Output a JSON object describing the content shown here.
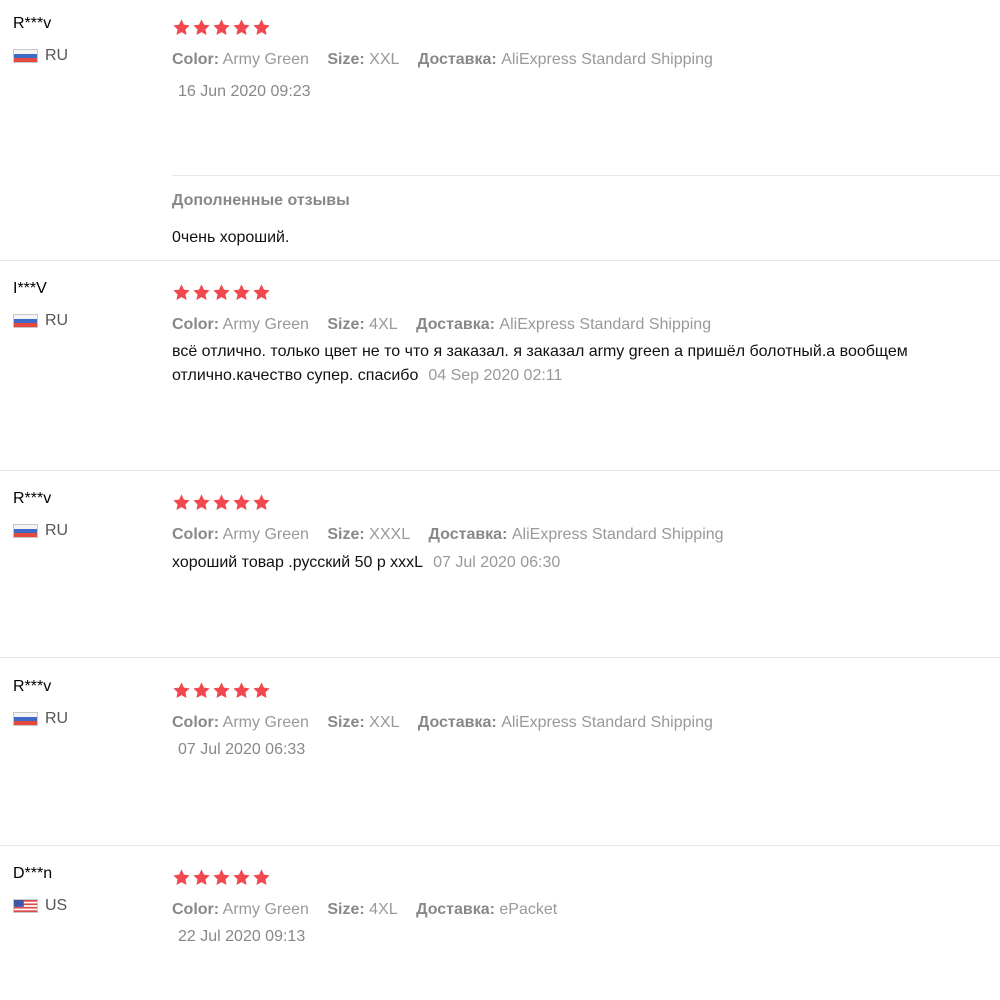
{
  "labels": {
    "color": "Color:",
    "size": "Size:",
    "shipping": "Доставка:"
  },
  "colors": {
    "star": "#f0484e",
    "meta_text": "#999999",
    "divider": "#e6e6e6"
  },
  "reviews": [
    {
      "user": "R***v",
      "country": "RU",
      "flag_icon": "russia-flag-icon",
      "rating": 5,
      "color": "Army Green",
      "size": "XXL",
      "shipping": "AliExpress Standard Shipping",
      "text": "",
      "date": "16 Jun 2020 09:23",
      "followup": {
        "title": "Дополненные отзывы",
        "text": "0чень хороший."
      }
    },
    {
      "user": "I***V",
      "country": "RU",
      "flag_icon": "russia-flag-icon",
      "rating": 5,
      "color": "Army Green",
      "size": "4XL",
      "shipping": "AliExpress Standard Shipping",
      "text": "всё отлично. только цвет не то что я заказал. я заказал army green а пришёл болотный.а вообщем отлично.качество супер. спасибо",
      "date": "04 Sep 2020 02:11"
    },
    {
      "user": "R***v",
      "country": "RU",
      "flag_icon": "russia-flag-icon",
      "rating": 5,
      "color": "Army Green",
      "size": "XXXL",
      "shipping": "AliExpress Standard Shipping",
      "text": "хороший товар .русский 50 р xxxL",
      "date": "07 Jul 2020 06:30"
    },
    {
      "user": "R***v",
      "country": "RU",
      "flag_icon": "russia-flag-icon",
      "rating": 5,
      "color": "Army Green",
      "size": "XXL",
      "shipping": "AliExpress Standard Shipping",
      "text": "",
      "date": "07 Jul 2020 06:33"
    },
    {
      "user": "D***n",
      "country": "US",
      "flag_icon": "usa-flag-icon",
      "rating": 5,
      "color": "Army Green",
      "size": "4XL",
      "shipping": "ePacket",
      "text": "",
      "date": "22 Jul 2020 09:13"
    }
  ]
}
